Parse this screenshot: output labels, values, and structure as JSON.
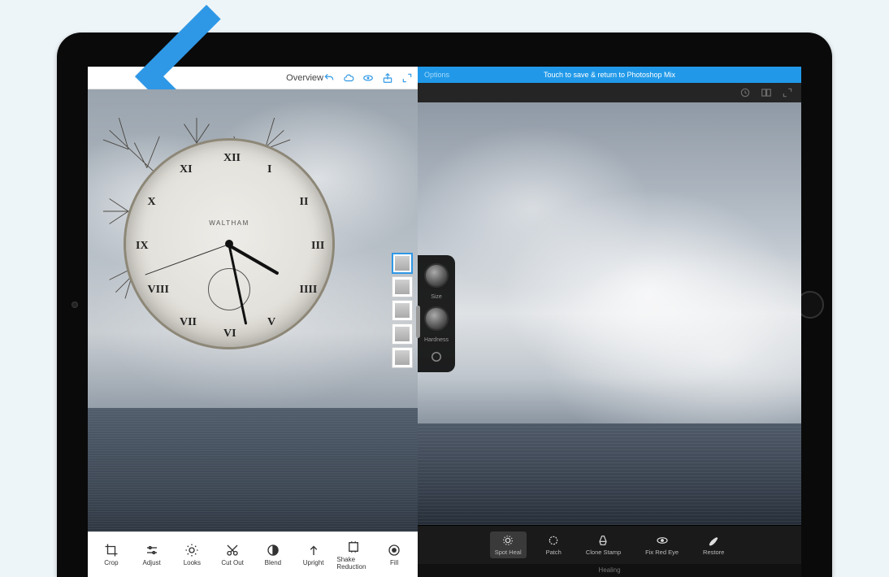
{
  "left": {
    "title": "Overview",
    "toolbar_icons": {
      "undo": "undo",
      "cloud": "cloud",
      "view": "view",
      "share": "share",
      "expand": "expand"
    },
    "clock": {
      "brand": "WALTHAM",
      "numerals": [
        "XII",
        "I",
        "II",
        "III",
        "IIII",
        "V",
        "VI",
        "VII",
        "VIII",
        "IX",
        "X",
        "XI"
      ]
    },
    "layers": [
      {
        "name": "layer-combined",
        "selected": true
      },
      {
        "name": "layer-clock",
        "selected": false
      },
      {
        "name": "layer-trees-1",
        "selected": false
      },
      {
        "name": "layer-trees-2",
        "selected": false
      },
      {
        "name": "layer-sea",
        "selected": false
      }
    ],
    "tools": [
      {
        "label": "Crop",
        "icon": "crop"
      },
      {
        "label": "Adjust",
        "icon": "adjust"
      },
      {
        "label": "Looks",
        "icon": "looks"
      },
      {
        "label": "Cut Out",
        "icon": "cutout"
      },
      {
        "label": "Blend",
        "icon": "blend"
      },
      {
        "label": "Upright",
        "icon": "upright"
      },
      {
        "label": "Shake Reduction",
        "icon": "shake"
      },
      {
        "label": "Fill",
        "icon": "fill"
      }
    ]
  },
  "right": {
    "options_label": "Options",
    "banner": "Touch to save & return to Photoshop Mix",
    "brush": {
      "size_label": "Size",
      "hardness_label": "Hardness"
    },
    "tools": [
      {
        "label": "Spot Heal",
        "icon": "spotheal",
        "selected": true
      },
      {
        "label": "Patch",
        "icon": "patch",
        "selected": false
      },
      {
        "label": "Clone Stamp",
        "icon": "clone",
        "selected": false
      },
      {
        "label": "Fix Red Eye",
        "icon": "redeye",
        "selected": false
      },
      {
        "label": "Restore",
        "icon": "restore",
        "selected": false
      }
    ],
    "mode_label": "Healing"
  },
  "colors": {
    "accent_blue": "#2199e8",
    "ios_blue": "#2f98e6"
  }
}
